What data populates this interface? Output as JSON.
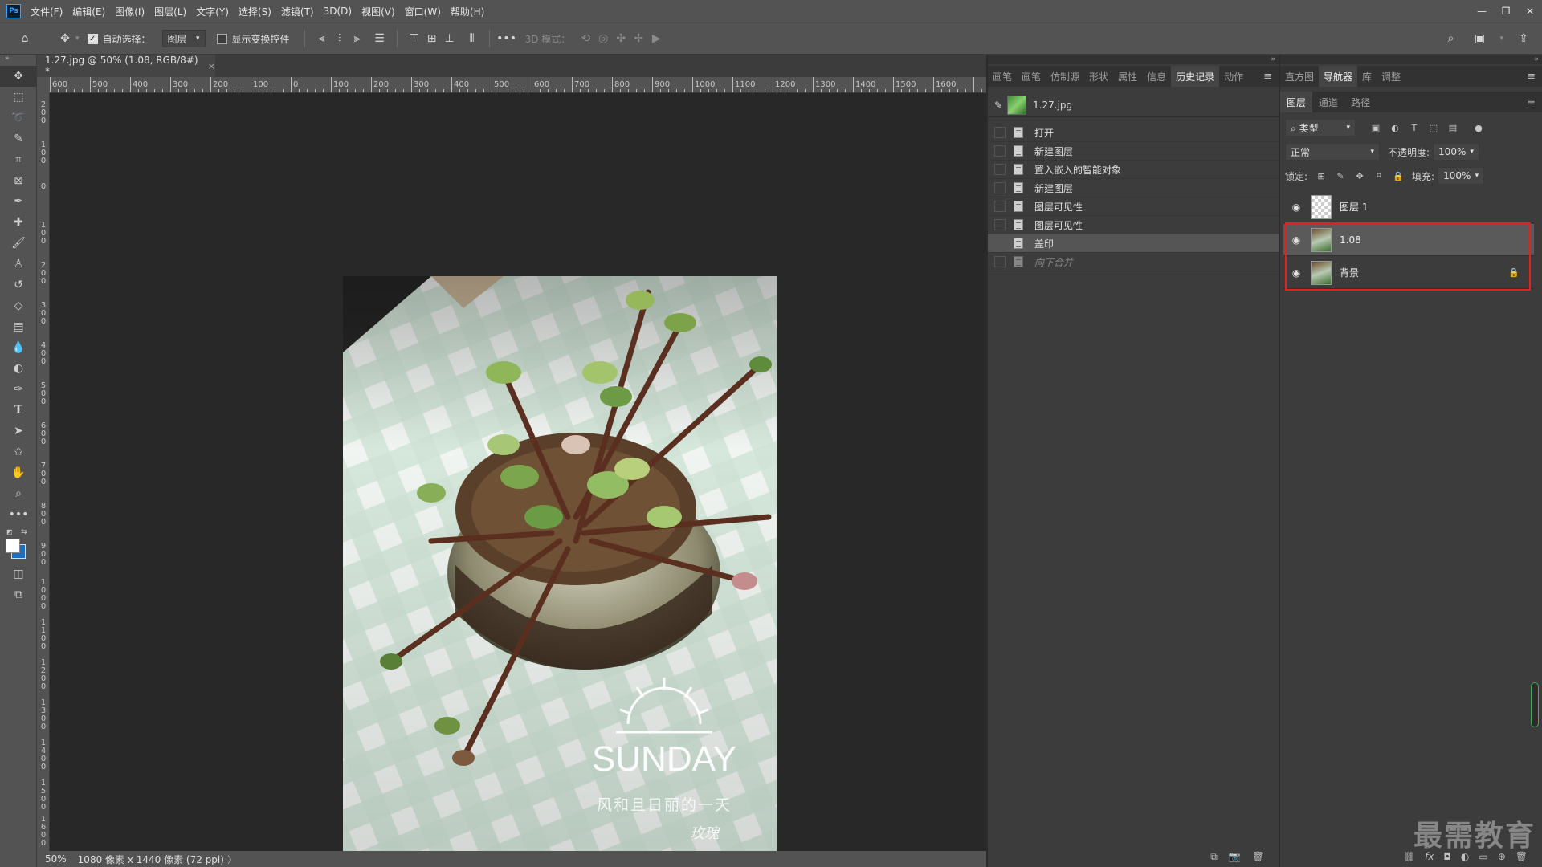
{
  "app": {
    "logo": "Ps"
  },
  "menu": [
    "文件(F)",
    "编辑(E)",
    "图像(I)",
    "图层(L)",
    "文字(Y)",
    "选择(S)",
    "滤镜(T)",
    "3D(D)",
    "视图(V)",
    "窗口(W)",
    "帮助(H)"
  ],
  "options": {
    "auto_select_label": "自动选择：",
    "auto_select_checked": true,
    "target_value": "图层",
    "show_transform_label": "显示变换控件",
    "mode_3d_label": "3D 模式："
  },
  "document": {
    "tab_title": "1.27.jpg @ 50% (1.08, RGB/8#) *",
    "close": "×",
    "ruler_h": [
      "600",
      "500",
      "400",
      "300",
      "200",
      "100",
      "0",
      "100",
      "200",
      "300",
      "400",
      "500",
      "600",
      "700",
      "800",
      "900",
      "1000",
      "1100",
      "1200",
      "1300",
      "1400",
      "1500",
      "1600"
    ],
    "ruler_v": [
      "2\n0\n0",
      "1\n0\n0",
      "0",
      "1\n0\n0",
      "2\n0\n0",
      "3\n0\n0",
      "4\n0\n0",
      "5\n0\n0",
      "6\n0\n0",
      "7\n0\n0",
      "8\n0\n0",
      "9\n0\n0",
      "1\n0\n0\n0",
      "1\n1\n0\n0",
      "1\n2\n0\n0",
      "1\n3\n0\n0",
      "1\n4\n0\n0",
      "1\n5\n0\n0",
      "1\n6\n0\n0"
    ],
    "photo_text": {
      "headline": "SUNDAY",
      "caption": "风和且日丽的一天",
      "signature": "玫瑰"
    }
  },
  "status": {
    "zoom": "50%",
    "info": "1080 像素 x 1440 像素 (72 ppi)",
    "arrow": "〉"
  },
  "panel1": {
    "tabs": [
      "画笔",
      "画笔",
      "仿制源",
      "形状",
      "属性",
      "信息",
      "历史记录",
      "动作"
    ],
    "active_tab": 6,
    "snapshot": "1.27.jpg",
    "history": [
      {
        "label": "打开",
        "state": "normal"
      },
      {
        "label": "新建图层",
        "state": "normal"
      },
      {
        "label": "置入嵌入的智能对象",
        "state": "normal"
      },
      {
        "label": "新建图层",
        "state": "normal"
      },
      {
        "label": "图层可见性",
        "state": "normal"
      },
      {
        "label": "图层可见性",
        "state": "normal"
      },
      {
        "label": "盖印",
        "state": "selected"
      },
      {
        "label": "向下合并",
        "state": "undone"
      }
    ]
  },
  "panel2": {
    "tabs": [
      "直方图",
      "导航器",
      "库",
      "调整"
    ],
    "active_tab": 1,
    "layer_tabs": [
      "图层",
      "通道",
      "路径"
    ],
    "filter_label": "类型",
    "blend_mode": "正常",
    "opacity_label": "不透明度:",
    "opacity_value": "100%",
    "lock_label": "锁定:",
    "fill_label": "填充:",
    "fill_value": "100%",
    "layers": [
      {
        "name": "图层 1",
        "thumb": "transparent",
        "selected": false,
        "locked": false
      },
      {
        "name": "1.08",
        "thumb": "photo",
        "selected": true,
        "locked": false
      },
      {
        "name": "背景",
        "thumb": "photo",
        "selected": false,
        "locked": true
      }
    ]
  },
  "watermark": "最需教育",
  "colors": {
    "highlight_box": "#e81e25",
    "ps_blue": "#31a8ff"
  }
}
